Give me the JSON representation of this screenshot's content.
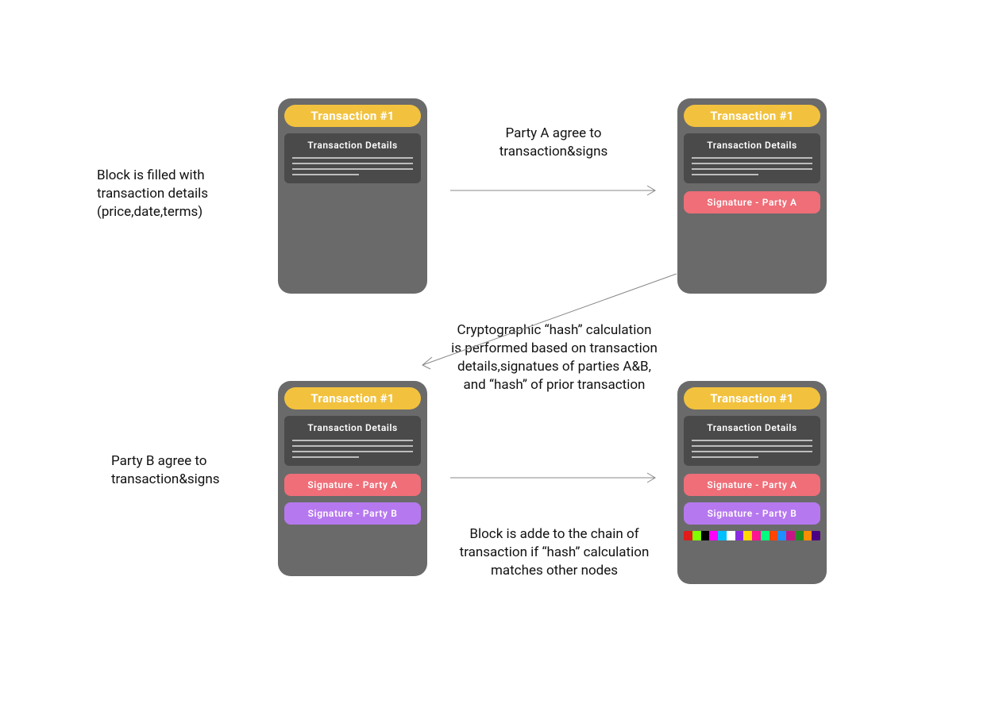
{
  "colors": {
    "block_bg": "#6a6a6a",
    "details_bg": "#4a4a4a",
    "header_bg": "#f2c23e",
    "sig_a_bg": "#ef6e78",
    "sig_b_bg": "#b678ef",
    "text_white": "#ffffff",
    "caption_text": "#111111",
    "arrow": "#888888",
    "hash_stripe": [
      "#e21b1b",
      "#7fff00",
      "#000000",
      "#ff00ff",
      "#00bfff",
      "#ffffff",
      "#8a2be2",
      "#ffd700",
      "#ff1493",
      "#00ff7f",
      "#ff4500",
      "#1e90ff",
      "#c71585",
      "#228b22",
      "#ff8c00",
      "#4b0082"
    ]
  },
  "captions": {
    "step1": "Block is filled with transaction details (price,date,terms)",
    "step2": "Party A agree to transaction&signs",
    "step3": "Party B agree to transaction&signs",
    "step4": "Cryptographic “hash” calculation is performed based on transaction details,signatues of parties A&B, and “hash” of prior transaction",
    "step5": "Block is adde to the chain of transaction if “hash” calculation matches other nodes"
  },
  "block": {
    "header": "Transaction #1",
    "details_title": "Transaction Details",
    "sig_a": "Signature - Party A",
    "sig_b": "Signature - Party B"
  }
}
